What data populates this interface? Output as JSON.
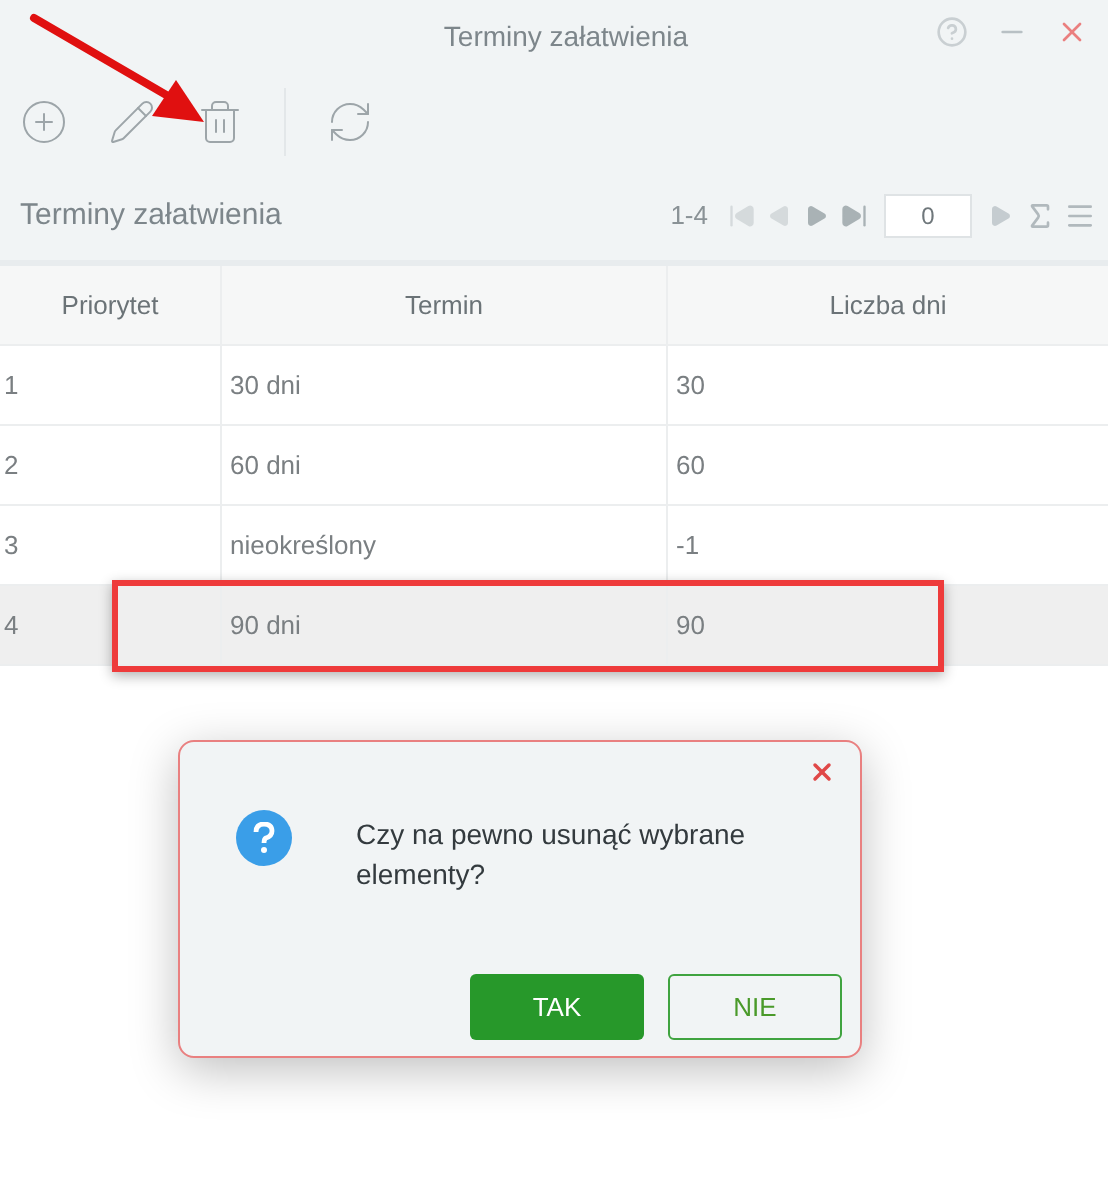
{
  "window": {
    "title": "Terminy załatwienia"
  },
  "toolbar": {
    "buttons": [
      {
        "kind": "add"
      },
      {
        "kind": "edit"
      },
      {
        "kind": "delete"
      },
      {
        "kind": "refresh"
      }
    ]
  },
  "grid": {
    "title": "Terminy załatwienia",
    "pager": {
      "range": "1-4",
      "page": "0",
      "buttons": [
        {
          "kind": "first",
          "disabled": true
        },
        {
          "kind": "prev",
          "disabled": true
        },
        {
          "kind": "next",
          "disabled": false
        },
        {
          "kind": "last",
          "disabled": false
        }
      ]
    }
  },
  "table": {
    "columns": [
      "Priorytet",
      "Termin",
      "Liczba dni"
    ],
    "rows": [
      {
        "cells": [
          "1",
          "30 dni",
          "30"
        ],
        "selected": false
      },
      {
        "cells": [
          "2",
          "60 dni",
          "60"
        ],
        "selected": false
      },
      {
        "cells": [
          "3",
          "nieokreślony",
          "-1"
        ],
        "selected": false
      },
      {
        "cells": [
          "4",
          "90 dni",
          "90"
        ],
        "selected": true
      }
    ]
  },
  "dialog": {
    "message": "Czy na pewno usunąć wybrane elementy?",
    "buttons": [
      {
        "label": "TAK",
        "kind": "primary"
      },
      {
        "label": "NIE",
        "kind": "secondary"
      }
    ]
  }
}
